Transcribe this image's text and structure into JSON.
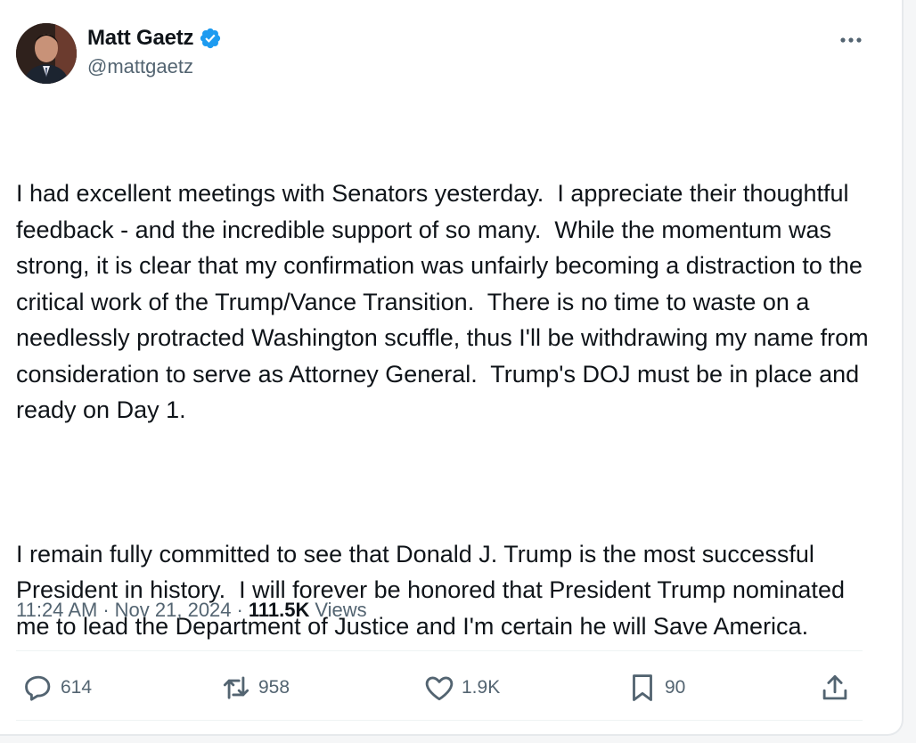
{
  "author": {
    "display_name": "Matt Gaetz",
    "handle": "@mattgaetz",
    "verified": true
  },
  "tweet": {
    "paragraphs": [
      "I had excellent meetings with Senators yesterday.  I appreciate their thoughtful feedback - and the incredible support of so many.  While the momentum was strong, it is clear that my confirmation was unfairly becoming a distraction to the critical work of the Trump/Vance Transition.  There is no time to waste on a needlessly protracted Washington scuffle, thus I'll be withdrawing my name from consideration to serve as Attorney General.  Trump's DOJ must be in place and ready on Day 1.",
      "I remain fully committed to see that Donald J. Trump is the most successful President in history.  I will forever be honored that President Trump nominated me to lead the Department of Justice and I'm certain he will Save America."
    ],
    "time": "11:24 AM",
    "date": "Nov 21, 2024",
    "views_count": "111.5K",
    "views_label": "Views"
  },
  "actions": {
    "replies": "614",
    "reposts": "958",
    "likes": "1.9K",
    "bookmarks": "90"
  },
  "icons": {
    "more": "more-horizontal-icon",
    "verified": "verified-badge-icon",
    "reply": "reply-icon",
    "repost": "repost-icon",
    "like": "heart-icon",
    "bookmark": "bookmark-icon",
    "share": "share-icon"
  },
  "colors": {
    "verified_blue": "#1d9bf0",
    "text_primary": "#0f1419",
    "text_secondary": "#536471"
  }
}
